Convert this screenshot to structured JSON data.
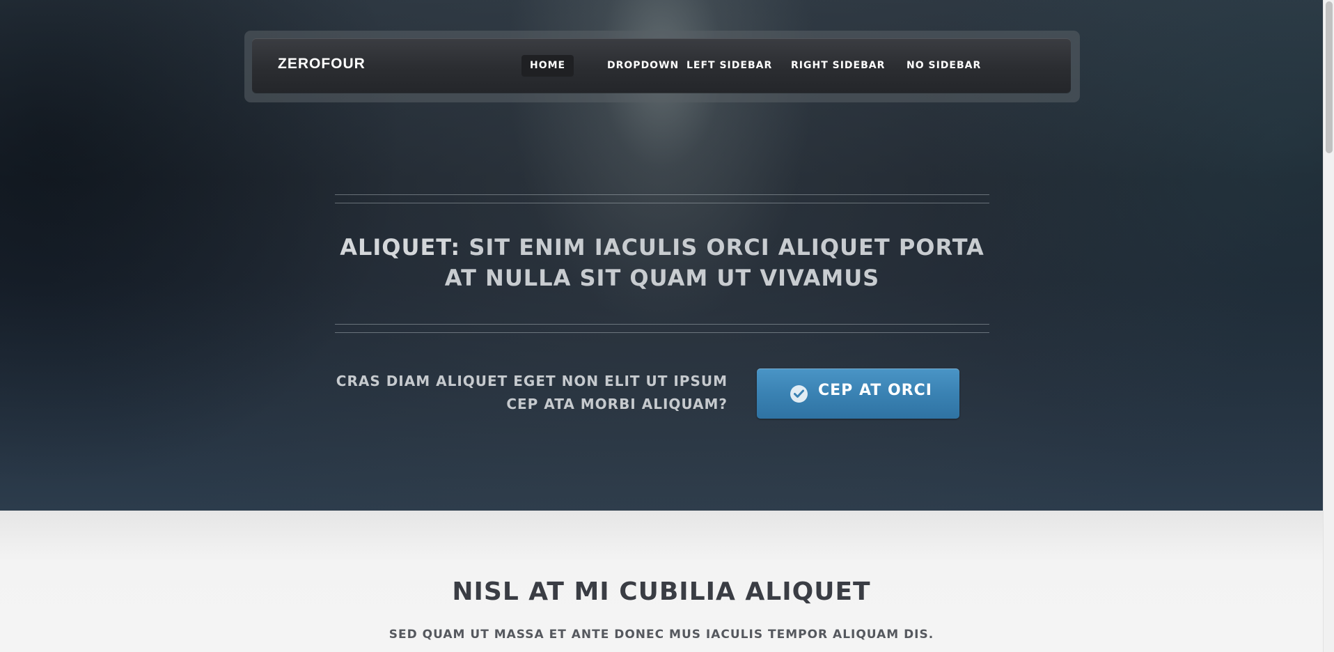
{
  "header": {
    "logo": "ZEROFOUR",
    "nav": [
      {
        "label": "HOME",
        "active": true
      },
      {
        "label": "DROPDOWN",
        "active": false
      },
      {
        "label": "LEFT SIDEBAR",
        "active": false
      },
      {
        "label": "RIGHT SIDEBAR",
        "active": false
      },
      {
        "label": "NO SIDEBAR",
        "active": false
      }
    ]
  },
  "hero": {
    "title_strong": "ALIQUET:",
    "title_rest": " SIT ENIM IACULIS ORCI ALIQUET PORTA AT NULLA SIT QUAM UT VIVAMUS",
    "cta_text": "CRAS DIAM ALIQUET EGET NON ELIT UT IPSUM CEP ATA MORBI ALIQUAM?",
    "cta_button_label": "CEP AT ORCI",
    "cta_button_icon": "check-circle-icon"
  },
  "main": {
    "title": "NISL AT MI CUBILIA ALIQUET",
    "subtitle": "SED QUAM UT MASSA ET ANTE DONEC MUS IACULIS TEMPOR ALIQUAM DIS."
  },
  "colors": {
    "accent": "#3a82b3",
    "nav_background": "#2b2d31",
    "hero_background": "#1b2430",
    "text_light": "#c8ccd0",
    "text_dark": "#3a3d44"
  }
}
